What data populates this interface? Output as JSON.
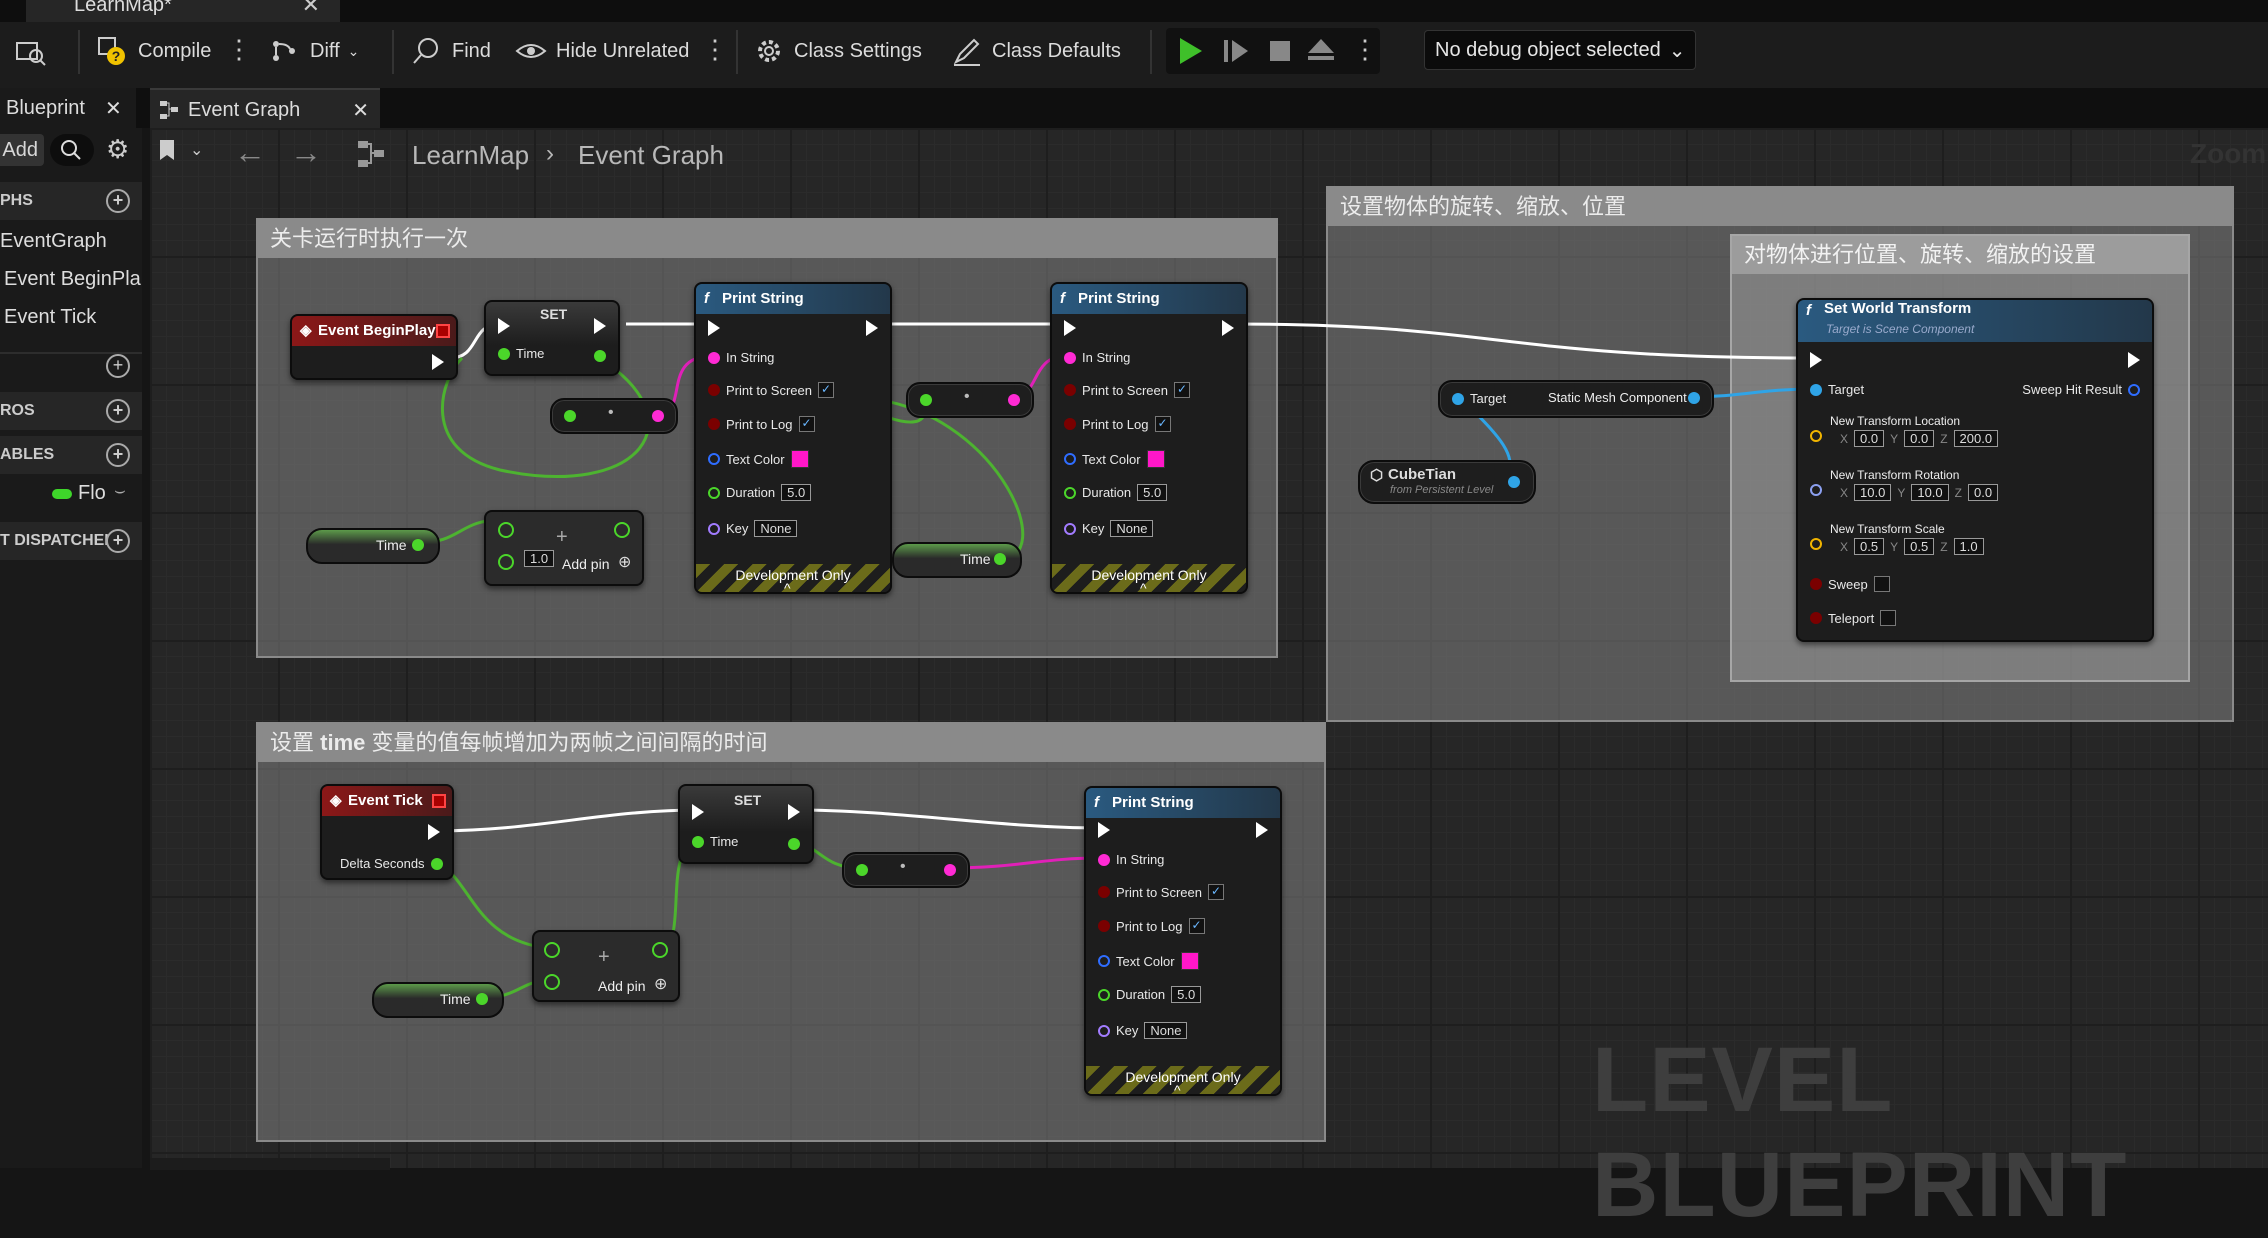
{
  "window": {
    "doc_tab": "LearnMap*"
  },
  "toolbar": {
    "compile": "Compile",
    "diff": "Diff",
    "find": "Find",
    "hide_unrelated": "Hide Unrelated",
    "class_settings": "Class Settings",
    "class_defaults": "Class Defaults",
    "debug_select": "No debug object selected"
  },
  "tabs": {
    "blueprint": "Blueprint",
    "event_graph": "Event Graph"
  },
  "left_panel": {
    "add": "Add",
    "graphs": "PHS",
    "items": [
      "EventGraph",
      "Event BeginPla",
      "Event Tick"
    ],
    "macros": "ROS",
    "variables": "ABLES",
    "var_type": "Flo",
    "dispatchers": "T DISPATCHEI"
  },
  "breadcrumb": {
    "root": "LearnMap",
    "current": "Event Graph",
    "zoom": "Zoom"
  },
  "comments": {
    "c1": "关卡运行时执行一次",
    "c2": "设置物体的旋转、缩放、位置",
    "c3": "对物体进行位置、旋转、缩放的设置",
    "c4_a": "设置 ",
    "c4_b": "time",
    "c4_c": " 变量的值每帧增加为两帧之间间隔的时间"
  },
  "nodes": {
    "begin_play": "Event BeginPlay",
    "set": "SET",
    "time": "Time",
    "print_string": "Print String",
    "in_string": "In String",
    "print_to_screen": "Print to Screen",
    "print_to_log": "Print to Log",
    "text_color": "Text Color",
    "duration": "Duration",
    "duration_val": "5.0",
    "key": "Key",
    "key_val": "None",
    "dev_only": "Development Only",
    "add_pin": "Add pin",
    "add_val": "1.0",
    "event_tick": "Event Tick",
    "delta_seconds": "Delta Seconds",
    "swt_title": "Set World Transform",
    "swt_sub": "Target is Scene Component",
    "target": "Target",
    "sweep_hit": "Sweep Hit Result",
    "static_mesh": "Static Mesh Component",
    "cubetian": "CubeTian",
    "cubetian_sub": "from Persistent Level",
    "new_loc": "New Transform Location",
    "new_rot": "New Transform Rotation",
    "new_scale": "New Transform Scale",
    "loc": [
      "0.0",
      "0.0",
      "200.0"
    ],
    "rot": [
      "10.0",
      "10.0",
      "0.0"
    ],
    "scale": [
      "0.5",
      "0.5",
      "1.0"
    ],
    "x": "X",
    "y": "Y",
    "z": "Z",
    "sweep": "Sweep",
    "teleport": "Teleport"
  },
  "watermark": "LEVEL BLUEPRINT",
  "colors": {
    "exec": "#ffffff",
    "float": "#5ad63a",
    "string": "#ff2ad4",
    "object": "#2fa4e7",
    "struct_vec": "#f0b400",
    "struct_rot": "#8ca0f0",
    "bool": "#8c0000",
    "color": "#ff17c8"
  }
}
